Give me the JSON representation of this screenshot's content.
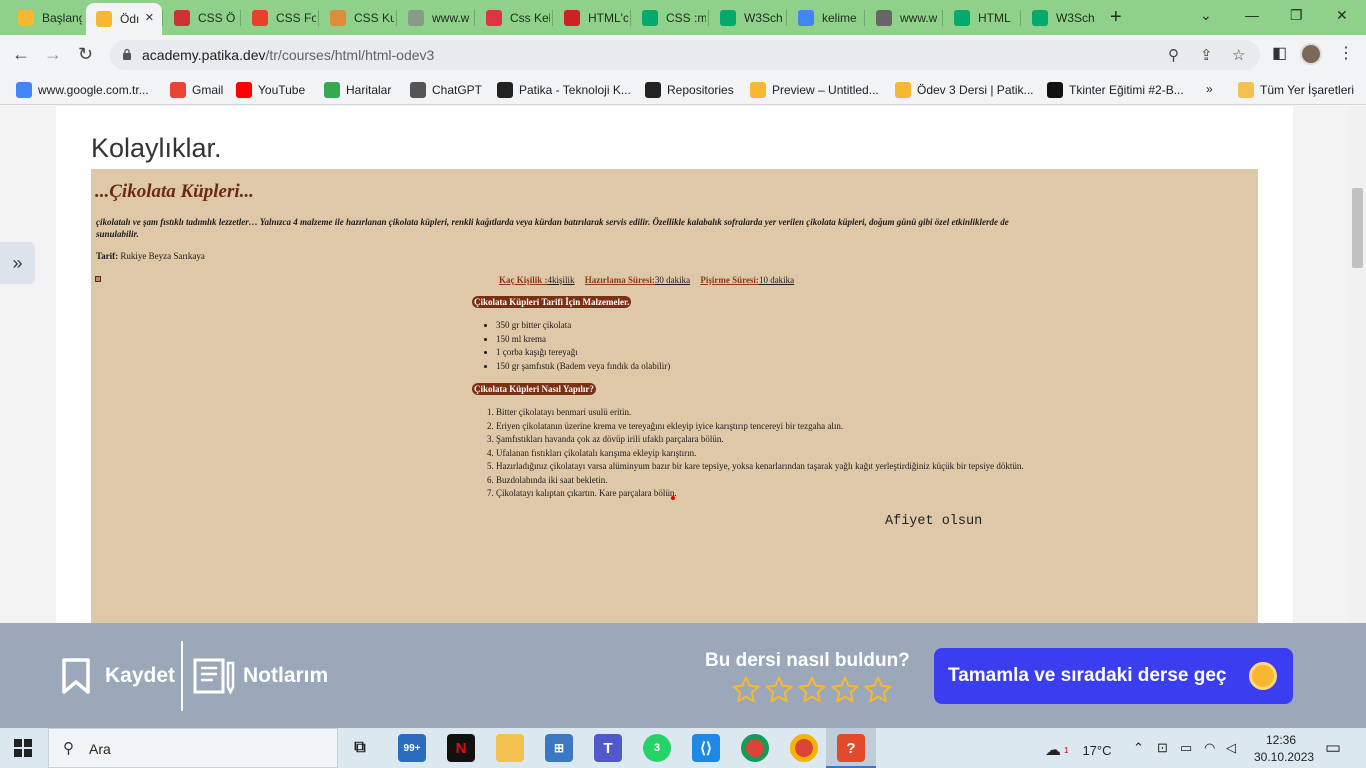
{
  "browser": {
    "tabs": [
      {
        "title": "Başlang",
        "favicon": "patika-icon",
        "color": "#f7b731"
      },
      {
        "title": "Ödı",
        "favicon": "patika-icon",
        "color": "#f7b731",
        "active": true
      },
      {
        "title": "CSS Ö",
        "favicon": "w3-icon",
        "color": "#cc3333"
      },
      {
        "title": "CSS Fo",
        "favicon": "t-icon",
        "color": "#e8402a"
      },
      {
        "title": "CSS Ku",
        "favicon": "kodlama-icon",
        "color": "#e08a3a"
      },
      {
        "title": "www.w",
        "favicon": "w-icon",
        "color": "#8a9a8a"
      },
      {
        "title": "Css Kel",
        "favicon": "a-icon",
        "color": "#dd3344"
      },
      {
        "title": "HTML'c",
        "favicon": "html-icon",
        "color": "#cc2222"
      },
      {
        "title": "CSS :m",
        "favicon": "w3-icon",
        "color": "#04aa6d"
      },
      {
        "title": "W3Sch",
        "favicon": "w3-icon",
        "color": "#04aa6d"
      },
      {
        "title": "kelime",
        "favicon": "google-icon",
        "color": "#4285f4"
      },
      {
        "title": "www.w",
        "favicon": "globe-icon",
        "color": "#666666"
      },
      {
        "title": "HTML",
        "favicon": "w3-icon",
        "color": "#04aa6d"
      },
      {
        "title": "W3Sch",
        "favicon": "w3-icon",
        "color": "#04aa6d"
      }
    ],
    "url_host": "academy.patika.dev",
    "url_path": "/tr/courses/html/html-odev3",
    "bookmarks": [
      {
        "label": "www.google.com.tr...",
        "icon": "google-icon",
        "color": "#4285f4"
      },
      {
        "label": "Gmail",
        "icon": "gmail-icon",
        "color": "#ea4335"
      },
      {
        "label": "YouTube",
        "icon": "youtube-icon",
        "color": "#ff0000"
      },
      {
        "label": "Haritalar",
        "icon": "maps-icon",
        "color": "#34a853"
      },
      {
        "label": "ChatGPT",
        "icon": "chatgpt-icon",
        "color": "#555555"
      },
      {
        "label": "Patika - Teknoloji K...",
        "icon": "patika-icon",
        "color": "#222222"
      },
      {
        "label": "Repositories",
        "icon": "github-icon",
        "color": "#222222"
      },
      {
        "label": "Preview – Untitled...",
        "icon": "preview-icon",
        "color": "#f7b731"
      },
      {
        "label": "Ödev 3 Dersi | Patik...",
        "icon": "patika-icon",
        "color": "#f7b731"
      },
      {
        "label": "Tkinter Eğitimi #2-B...",
        "icon": "tkinter-icon",
        "color": "#111111"
      }
    ],
    "bookmarks_more": "»",
    "all_bookmarks": "Tüm Yer İşaretleri"
  },
  "page": {
    "heading": "Kolaylıklar.",
    "recipe": {
      "title": "...Çikolata Küpleri...",
      "description": "çikolatalı ve şam fıstıklı tadımlık lezzetler… Yalnızca 4 malzeme ile hazırlanan çikolata küpleri, renkli kağıtlarda veya kürdan batırılarak servis edilir. Özellikle kalabalık sofralarda yer verilen çikolata küpleri, doğum günü gibi özel etkinliklerde de sunulabilir.",
      "author_label": "Tarif:",
      "author": "Rukiye Beyza Sarıkaya",
      "info": [
        {
          "key": "Kaç Kişilik :",
          "value": "4kişilik"
        },
        {
          "key": "Hazırlama Süresi:",
          "value": "30 dakika"
        },
        {
          "key": "Pişirme Süresi:",
          "value": "10 dakika"
        }
      ],
      "ingredients_heading": "Çikolata Küpleri Tarifi İçin Malzemeler.",
      "ingredients": [
        "350 gr bitter çikolata",
        "150 ml krema",
        "1 çorba kaşığı tereyağı",
        "150 gr şamfıstık (Badem veya fındık da olabilir)"
      ],
      "steps_heading": "Çikolata Küpleri Nasıl Yapılır?",
      "steps": [
        "Bitter çikolatayı benmari usulü eritin.",
        "Eriyen çikolatanın üzerine krema ve tereyağını ekleyip iyice karıştırıp tencereyi bir tezgaha alın.",
        "Şamfıstıkları havanda çok az dövüp irili ufaklı parçalara bölün.",
        "Ufalanan fıstıkları çikolatalı karışıma ekleyip karıştırın.",
        "Hazırladığınız çikolatayı varsa alüminyum bazır bir kare tepsiye, yoksa kenarlarından taşarak yağlı kağıt yerleştirdiğiniz küçük bir tepsiye döktün.",
        "Buzdolabında iki saat bekletin.",
        "Çikolatayı kalıptan çıkartın. Kare parçalara bölün."
      ],
      "closing": "Afiyet olsun"
    }
  },
  "lessonbar": {
    "save_label": "Kaydet",
    "notes_label": "Notlarım",
    "rating_question": "Bu dersi nasıl buldun?",
    "rating": 0,
    "rating_max": 5,
    "complete_label": "Tamamla ve sıradaki derse geç"
  },
  "taskbar": {
    "search_label": "Ara",
    "mail_badge": "99+",
    "whatsapp_badge": "3",
    "weather_badge": "1",
    "weather": "17°C",
    "time": "12:36",
    "date": "30.10.2023"
  },
  "colors": {
    "tabstrip": "#8fd18b",
    "recipe_bg": "#dfc8a8",
    "recipe_accent": "#7a2e12",
    "lessonbar": "#9ba8ba",
    "complete_button": "#3b3ef0"
  }
}
